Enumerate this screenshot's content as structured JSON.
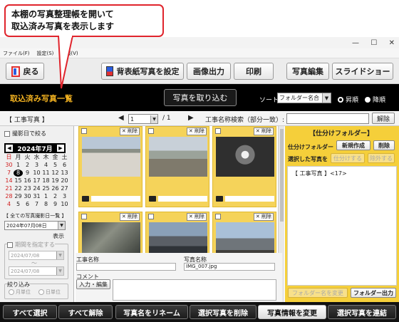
{
  "callout": {
    "line1": "本棚の写真整理帳を開いて",
    "line2": "取込済み写真を表示します"
  },
  "window": {
    "controls": [
      "—",
      "☐",
      "✕"
    ]
  },
  "menu": [
    "ファイル(F)",
    "設定(S)",
    "情報(V)"
  ],
  "toolbar": {
    "back_label": "戻る",
    "set_cover_label": "背表紙写真を設定",
    "image_output_label": "画像出力",
    "print_label": "印刷",
    "photo_edit_label": "写真編集",
    "slideshow_label": "スライドショー"
  },
  "header": {
    "title": "取込済み写真一覧",
    "import_label": "写真を取り込む",
    "sort_label": "ソート",
    "sort_value": "フォルダー名合",
    "asc_label": "昇順",
    "desc_label": "降順"
  },
  "pager": {
    "folder": "【 工事写真 】",
    "prev": "◀",
    "page_value": "1",
    "total": "/ 1",
    "next": "▶",
    "search_label": "工事名称検索（部分一致）:",
    "search_value": "",
    "search_button": "解除"
  },
  "left": {
    "filter_label": "撮影日で絞る",
    "cal_title": "2024年7月",
    "cal_prev": "◀",
    "cal_next": "▶",
    "weekdays": [
      "日",
      "月",
      "火",
      "水",
      "木",
      "金",
      "土"
    ],
    "days": [
      "30",
      "1",
      "2",
      "3",
      "4",
      "5",
      "6",
      "7",
      "8",
      "9",
      "10",
      "11",
      "12",
      "13",
      "14",
      "15",
      "16",
      "17",
      "18",
      "19",
      "20",
      "21",
      "22",
      "23",
      "24",
      "25",
      "26",
      "27",
      "28",
      "29",
      "30",
      "31",
      "1",
      "2",
      "3",
      "4",
      "5",
      "6",
      "7",
      "8",
      "9",
      "10"
    ],
    "all_dates_label": "【 全ての写真撮影日一覧 】",
    "date_value": "2024年07月08日",
    "show_label": "表示",
    "period_label": "期間を指定する",
    "from_value": "2024/07/08",
    "tilde": "～",
    "to_value": "2024/07/08",
    "narrow_label": "絞り込み",
    "month_unit": "月単位",
    "day_unit": "日単位"
  },
  "tiles": [
    {
      "del": "削除"
    },
    {
      "del": "削除"
    },
    {
      "del": "削除"
    },
    {
      "del": "削除"
    },
    {
      "del": "削除"
    },
    {
      "del": "削除"
    }
  ],
  "info": {
    "work_name_label": "工事名称",
    "work_name_value": "",
    "photo_name_label": "写真名称",
    "photo_name_value": "IMG_007.jpg",
    "comment_label": "コメント",
    "edit_label": "入力・編集",
    "comment_value": ""
  },
  "right": {
    "title": "【仕分けフォルダー】",
    "folder_label": "仕分けフォルダー",
    "new_label": "新規作成",
    "delete_label": "削除",
    "selected_label": "選択した写真を",
    "sort_in_label": "仕分けする",
    "remove_label": "除外する",
    "tree_item": "【 工事写真 】<17>",
    "rename_label": "フォルダー名を変更",
    "output_label": "フォルダー出力"
  },
  "bottom": {
    "select_all": "すべて選択",
    "deselect_all": "すべて解除",
    "rename": "写真名をリネーム",
    "delete_selected": "選択写真を削除",
    "change_info": "写真情報を変更",
    "link_selected": "選択写真を連結"
  }
}
